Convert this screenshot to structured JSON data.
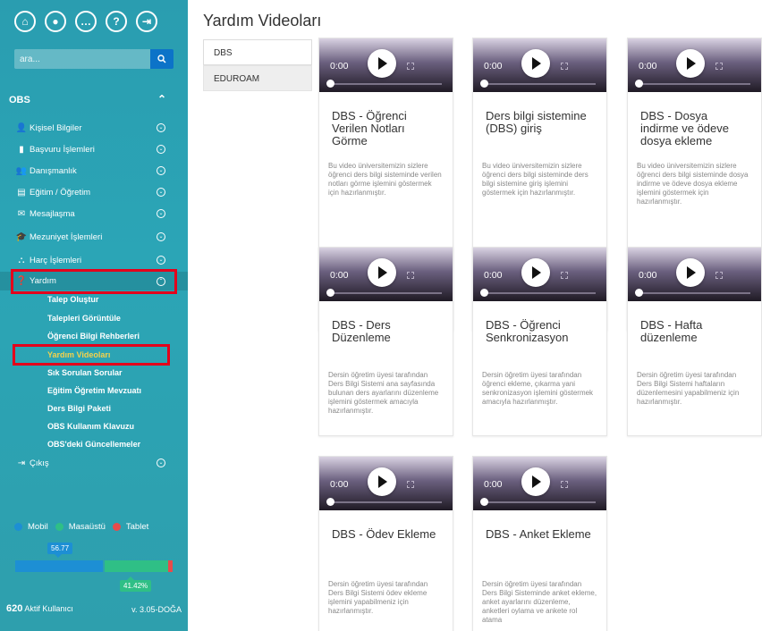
{
  "sidebar": {
    "top_icons": [
      "home-icon",
      "user-icon",
      "chat-icon",
      "help-icon",
      "logout-icon"
    ],
    "search": {
      "placeholder": "ara..."
    },
    "section_title": "OBS",
    "menu": [
      {
        "label": "Kişisel Bilgiler",
        "icon": "user-icon"
      },
      {
        "label": "Başvuru İşlemleri",
        "icon": "briefcase-icon"
      },
      {
        "label": "Danışmanlık",
        "icon": "users-icon"
      },
      {
        "label": "Eğitim / Öğretim",
        "icon": "book-icon"
      },
      {
        "label": "Mesajlaşma",
        "icon": "envelope-icon"
      },
      {
        "label": "Mezuniyet İşlemleri",
        "icon": "graduation-cap-icon"
      },
      {
        "label": "Harç İşlemleri",
        "icon": "sitemap-icon"
      },
      {
        "label": "Yardım",
        "icon": "question-circle-icon"
      }
    ],
    "submenu": [
      "Talep Oluştur",
      "Talepleri Görüntüle",
      "Öğrenci Bilgi Rehberleri",
      "Yardım Videoları",
      "Sık Sorulan Sorular",
      "Eğitim Öğretim Mevzuatı",
      "Ders Bilgi Paketi",
      "OBS Kullanım Klavuzu",
      "OBS'deki Güncellemeler"
    ],
    "active_submenu": "Yardım Videoları",
    "exit_label": "Çıkış",
    "legend": [
      {
        "label": "Mobil",
        "color": "#1d8fd4"
      },
      {
        "label": "Masaüstü",
        "color": "#2fbf86"
      },
      {
        "label": "Tablet",
        "color": "#e84b4b"
      }
    ],
    "usage": {
      "mobile_label": "56.77",
      "desktop_label": "41.42%",
      "mobile": 56.77,
      "desktop": 41.42,
      "tablet": 1.81
    },
    "active_users_count": "620",
    "active_users_label": "Aktif Kullanıcı",
    "version": "v. 3.05-DOĞA"
  },
  "main": {
    "title": "Yardım Videoları",
    "tabs": [
      {
        "label": "DBS"
      },
      {
        "label": "EDUROAM"
      }
    ],
    "video_time": "0:00",
    "cards": [
      {
        "title": "DBS - Öğrenci Verilen Notları Görme",
        "desc": "Bu video üniversitemizin sizlere öğrenci ders bilgi sisteminde verilen notları görme işlemini göstermek için hazırlanmıştır."
      },
      {
        "title": "Ders bilgi sistemine (DBS) giriş",
        "desc": "Bu video üniversitemizin sizlere öğrenci ders bilgi sisteminde ders bilgi sistemine giriş işlemini göstermek için hazırlanmıştır."
      },
      {
        "title": "DBS - Dosya indirme ve ödeve dosya ekleme",
        "desc": "Bu video üniversitemizin sizlere öğrenci ders bilgi sisteminde dosya indirme ve ödeve dosya ekleme işlemini göstermek için hazırlanmıştır."
      },
      {
        "title": "DBS - Ders Düzenleme",
        "desc": "Dersin öğretim üyesi tarafından Ders Bilgi Sistemi ana sayfasında bulunan ders ayarlarını düzenleme işlemini göstermek amacıyla hazırlanmıştır."
      },
      {
        "title": "DBS - Öğrenci Senkronizasyon",
        "desc": "Dersin öğretim üyesi tarafından öğrenci ekleme, çıkarma yani senkronizasyon işlemini göstermek amacıyla hazırlanmıştır."
      },
      {
        "title": "DBS - Hafta düzenleme",
        "desc": "Dersin öğretim üyesi tarafından Ders Bilgi Sistemi haftaların düzenlemesini yapabilmeniz için hazırlanmıştır."
      },
      {
        "title": "DBS - Ödev Ekleme",
        "desc": "Dersin öğretim üyesi tarafından Ders Bilgi Sistemi ödev ekleme işlemini yapabilmeniz için hazırlanmıştır."
      },
      {
        "title": "DBS - Anket Ekleme",
        "desc": "Dersin öğretim üyesi tarafından Ders Bilgi Sisteminde anket ekleme, anket ayarlarını düzenleme, anketleri oylama ve ankete rol atama"
      }
    ]
  }
}
